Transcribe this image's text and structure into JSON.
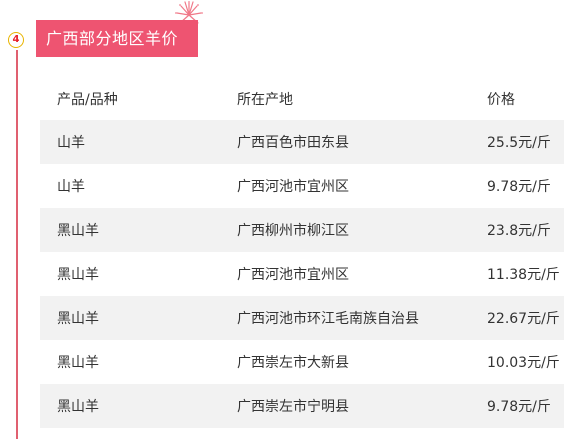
{
  "section": {
    "number": "4",
    "title": "广西部分地区羊价"
  },
  "table": {
    "headers": {
      "product": "产品/品种",
      "location": "所在产地",
      "price": "价格"
    },
    "rows": [
      {
        "product": "山羊",
        "location": "广西百色市田东县",
        "price": "25.5元/斤"
      },
      {
        "product": "山羊",
        "location": "广西河池市宜州区",
        "price": "9.78元/斤"
      },
      {
        "product": "黑山羊",
        "location": "广西柳州市柳江区",
        "price": "23.8元/斤"
      },
      {
        "product": "黑山羊",
        "location": "广西河池市宜州区",
        "price": "11.38元/斤"
      },
      {
        "product": "黑山羊",
        "location": "广西河池市环江毛南族自治县",
        "price": "22.67元/斤"
      },
      {
        "product": "黑山羊",
        "location": "广西崇左市大新县",
        "price": "10.03元/斤"
      },
      {
        "product": "黑山羊",
        "location": "广西崇左市宁明县",
        "price": "9.78元/斤"
      }
    ]
  },
  "colors": {
    "title_bg": "#ee5471",
    "badge_border": "#e8b400",
    "badge_text": "#e8202a",
    "timeline": "#e06070",
    "row_stripe": "#f2f2f2"
  },
  "icons": {
    "decoration": "firework-icon"
  }
}
